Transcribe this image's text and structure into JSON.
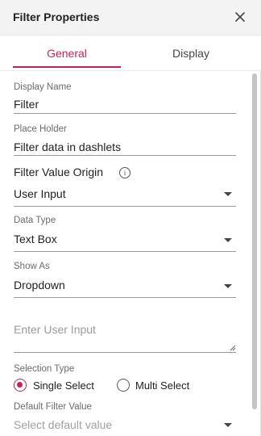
{
  "header": {
    "title": "Filter Properties"
  },
  "tabs": [
    {
      "label": "General",
      "active": true
    },
    {
      "label": "Display",
      "active": false
    }
  ],
  "fields": {
    "display_name": {
      "label": "Display Name",
      "value": "Filter"
    },
    "place_holder": {
      "label": "Place Holder",
      "value": "Filter data in dashlets"
    },
    "filter_value_origin": {
      "label": "Filter Value Origin",
      "value": "User Input"
    },
    "data_type": {
      "label": "Data Type",
      "value": "Text Box"
    },
    "show_as": {
      "label": "Show As",
      "value": "Dropdown"
    },
    "user_input": {
      "placeholder": "Enter User Input"
    },
    "selection_type": {
      "label": "Selection Type",
      "options": [
        {
          "label": "Single Select",
          "selected": true
        },
        {
          "label": "Multi Select",
          "selected": false
        }
      ]
    },
    "default_filter_value": {
      "label": "Default Filter Value",
      "placeholder": "Select default value"
    }
  },
  "colors": {
    "accent": "#c81f5a",
    "header_bg": "#f3f3f3"
  },
  "icons": {
    "close": "close-icon",
    "info": "info-icon",
    "caret": "caret-down-icon"
  }
}
